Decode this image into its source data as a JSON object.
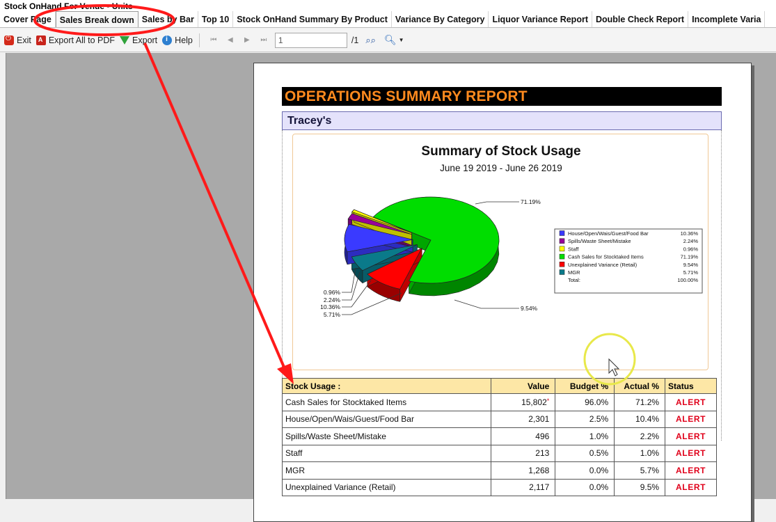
{
  "window": {
    "title": "Stock OnHand For Venue - Units"
  },
  "tabs": [
    {
      "label": "Cover Page"
    },
    {
      "label": "Sales Break down"
    },
    {
      "label": "Sales by Bar"
    },
    {
      "label": "Top 10"
    },
    {
      "label": "Stock OnHand Summary By Product"
    },
    {
      "label": "Variance By Category"
    },
    {
      "label": "Liquor Variance Report"
    },
    {
      "label": "Double Check Report"
    },
    {
      "label": "Incomplete Varia"
    }
  ],
  "toolbar": {
    "exit_label": "Exit",
    "export_pdf_label": "Export All to PDF",
    "export_label": "Export",
    "help_label": "Help",
    "page_value": "1",
    "page_total": "/1"
  },
  "report": {
    "title": "OPERATIONS SUMMARY REPORT",
    "venue": "Tracey's"
  },
  "chart_data": {
    "type": "pie",
    "title": "Summary of Stock Usage",
    "subtitle": "June 19 2019 - June 26 2019",
    "slices": [
      {
        "name": "House/Open/Wais/Guest/Food Bar",
        "value": 10.36,
        "label": "10.36%",
        "legend_value": "10.36%",
        "color": "#3a3aff"
      },
      {
        "name": "Spills/Waste Sheet/Mistake",
        "value": 2.24,
        "label": "2.24%",
        "legend_value": "2.24%",
        "color": "#990099"
      },
      {
        "name": "Staff",
        "value": 0.96,
        "label": "0.96%",
        "legend_value": "0.96%",
        "color": "#ffff00"
      },
      {
        "name": "Cash Sales for Stocktaked Items",
        "value": 71.19,
        "label": "71.19%",
        "legend_value": "71.19%",
        "color": "#00dd00"
      },
      {
        "name": "Unexplained Variance (Retail)",
        "value": 9.54,
        "label": "9.54%",
        "legend_value": "9.54%",
        "color": "#ff0000"
      },
      {
        "name": "MGR",
        "value": 5.71,
        "label": "5.71%",
        "legend_value": "5.71%",
        "color": "#0a7a8a"
      }
    ],
    "legend_total_label": "Total:",
    "legend_total_value": "100.00%",
    "legend": "right"
  },
  "table": {
    "headers": [
      "Stock Usage :",
      "Value",
      "Budget %",
      "Actual %",
      "Status"
    ],
    "rows": [
      {
        "name": "Cash Sales for Stocktaked Items",
        "value": "15,802",
        "flag": "*",
        "budget": "96.0%",
        "actual": "71.2%",
        "status": "ALERT"
      },
      {
        "name": "House/Open/Wais/Guest/Food Bar",
        "value": "2,301",
        "flag": "",
        "budget": "2.5%",
        "actual": "10.4%",
        "status": "ALERT"
      },
      {
        "name": "Spills/Waste Sheet/Mistake",
        "value": "496",
        "flag": "",
        "budget": "1.0%",
        "actual": "2.2%",
        "status": "ALERT"
      },
      {
        "name": "Staff",
        "value": "213",
        "flag": "",
        "budget": "0.5%",
        "actual": "1.0%",
        "status": "ALERT"
      },
      {
        "name": "MGR",
        "value": "1,268",
        "flag": "",
        "budget": "0.0%",
        "actual": "5.7%",
        "status": "ALERT"
      },
      {
        "name": "Unexplained Variance (Retail)",
        "value": "2,117",
        "flag": "",
        "budget": "0.0%",
        "actual": "9.5%",
        "status": "ALERT"
      }
    ]
  },
  "colors": {
    "title_bg": "#000000",
    "title_fg": "#ff8a1e",
    "alert": "#e0001a",
    "annotation": "#ff1a1a",
    "cursor_highlight": "#e8e84a"
  }
}
